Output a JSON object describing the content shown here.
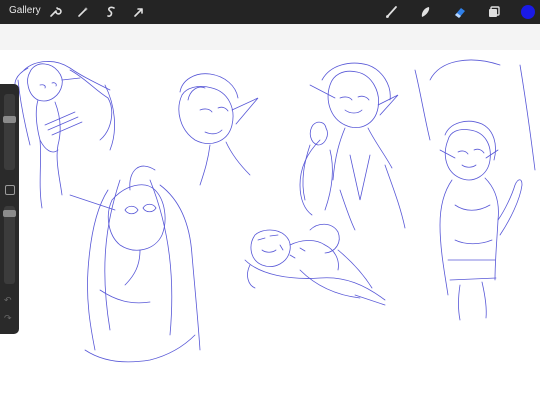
{
  "toolbar": {
    "gallery_label": "Gallery",
    "icons_left": [
      "wrench-icon",
      "magic-wand-icon",
      "selection-icon",
      "transform-arrow-icon"
    ],
    "icons_right": [
      "brush-icon",
      "smudge-icon",
      "eraser-icon",
      "layers-icon",
      "color-swatch-icon"
    ],
    "active_tool": "eraser",
    "current_color": "#1a1ae6"
  },
  "sidebar": {
    "brush_size_label": "",
    "opacity_label": ""
  },
  "colors": {
    "sketch_ink": "#3a3ad0",
    "toolbar_bg": "#242424"
  }
}
